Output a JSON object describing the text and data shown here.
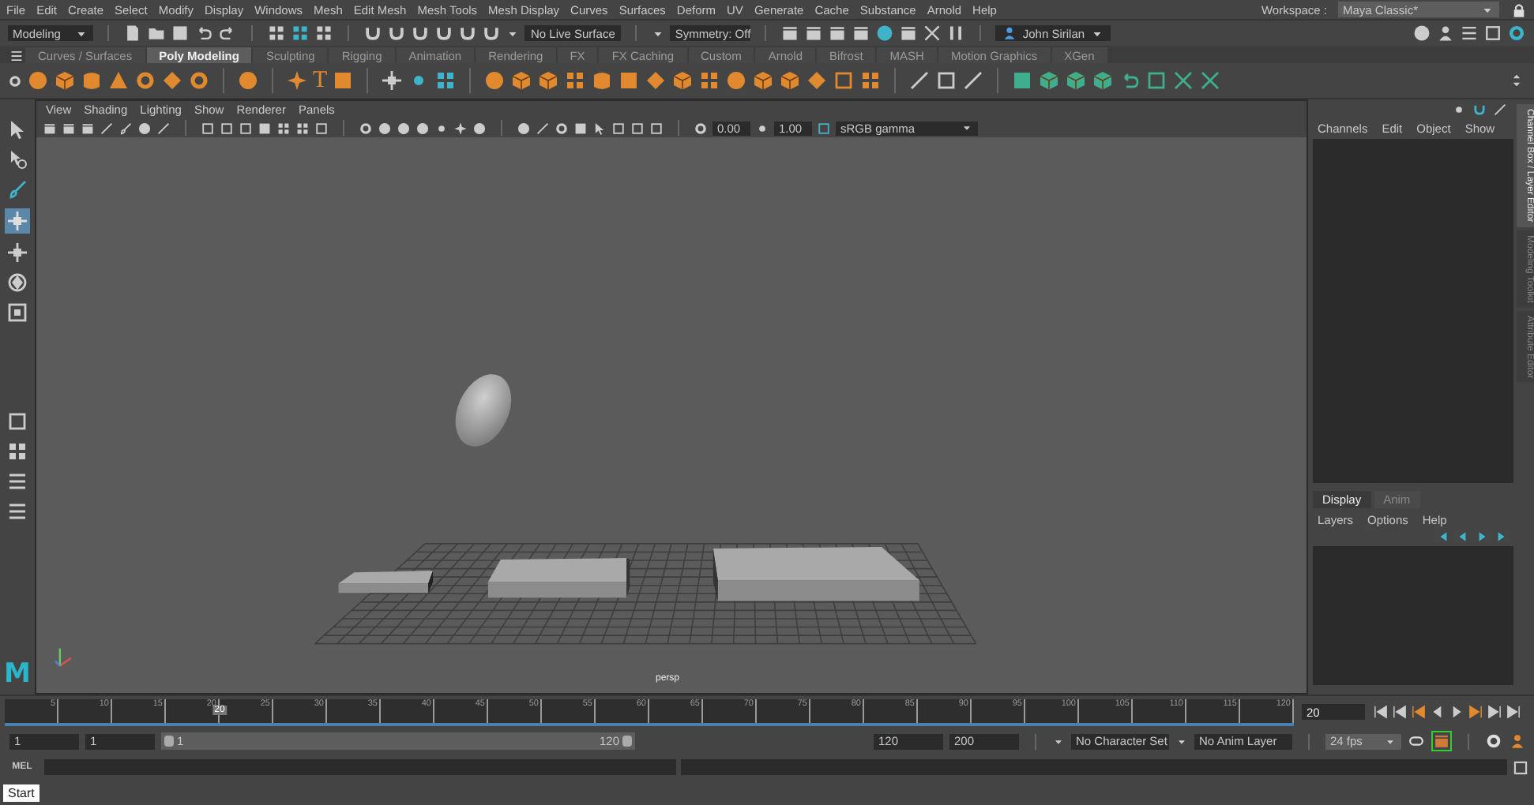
{
  "menu_bar": [
    "File",
    "Edit",
    "Create",
    "Select",
    "Modify",
    "Display",
    "Windows",
    "Mesh",
    "Edit Mesh",
    "Mesh Tools",
    "Mesh Display",
    "Curves",
    "Surfaces",
    "Deform",
    "UV",
    "Generate",
    "Cache",
    "Substance",
    "Arnold",
    "Help"
  ],
  "workspace": {
    "label": "Workspace :",
    "value": "Maya Classic*"
  },
  "status_line": {
    "mode": "Modeling",
    "live_surface": "No Live Surface",
    "symmetry": "Symmetry: Off",
    "user": "John Sirilan"
  },
  "shelf_tabs": [
    {
      "label": "Curves / Surfaces",
      "selected": false
    },
    {
      "label": "Poly Modeling",
      "selected": true
    },
    {
      "label": "Sculpting",
      "selected": false
    },
    {
      "label": "Rigging",
      "selected": false
    },
    {
      "label": "Animation",
      "selected": false
    },
    {
      "label": "Rendering",
      "selected": false
    },
    {
      "label": "FX",
      "selected": false
    },
    {
      "label": "FX Caching",
      "selected": false
    },
    {
      "label": "Custom",
      "selected": false
    },
    {
      "label": "Arnold",
      "selected": false
    },
    {
      "label": "Bifrost",
      "selected": false
    },
    {
      "label": "MASH",
      "selected": false
    },
    {
      "label": "Motion Graphics",
      "selected": false
    },
    {
      "label": "XGen",
      "selected": false
    }
  ],
  "shelf": {
    "text_tool": "T"
  },
  "viewport": {
    "menu": [
      "View",
      "Shading",
      "Lighting",
      "Show",
      "Renderer",
      "Panels"
    ],
    "exposure": "0.00",
    "gamma": "1.00",
    "color_space": "sRGB gamma",
    "camera": "persp",
    "logo": "M"
  },
  "channel_box": {
    "menu": [
      "Channels",
      "Edit",
      "Object",
      "Show"
    ]
  },
  "layer_editor": {
    "tabs": [
      {
        "label": "Display",
        "selected": true
      },
      {
        "label": "Anim",
        "selected": false
      }
    ],
    "menu": [
      "Layers",
      "Options",
      "Help"
    ]
  },
  "side_tabs": [
    {
      "label": "Channel Box / Layer Editor",
      "selected": true
    },
    {
      "label": "Modeling Toolkit",
      "selected": false
    },
    {
      "label": "Attribute Editor",
      "selected": false
    }
  ],
  "timeline": {
    "ticks": [
      "5",
      "10",
      "15",
      "20",
      "25",
      "30",
      "35",
      "40",
      "45",
      "50",
      "55",
      "60",
      "65",
      "70",
      "75",
      "80",
      "85",
      "90",
      "95",
      "100",
      "105",
      "110",
      "115",
      "120"
    ],
    "current_frame": "20",
    "level": 0.1667,
    "frame_field": "20"
  },
  "range": {
    "level": 1,
    "start": "1",
    "playback_start": "1",
    "slider_start": "1",
    "slider_end": "120",
    "playback_end": "120",
    "end": "200",
    "character_set": "No Character Set",
    "anim_layer": "No Anim Layer",
    "fps": "24 fps"
  },
  "command_line": {
    "language": "MEL"
  },
  "help_line": {
    "button": "Start"
  }
}
